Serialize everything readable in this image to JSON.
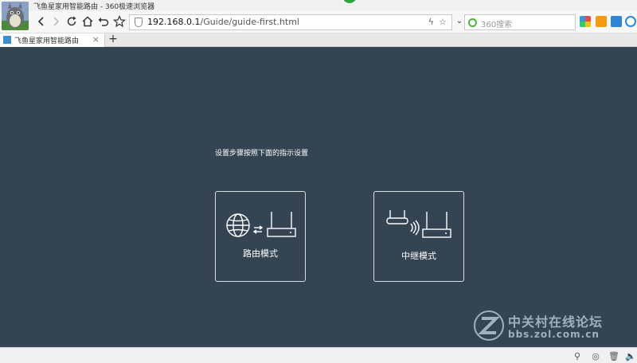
{
  "window": {
    "title": "飞鱼星家用智能路由 - 360极速浏览器"
  },
  "toolbar": {
    "back_icon": "back-arrow-icon",
    "forward_icon": "forward-arrow-icon",
    "refresh_icon": "refresh-icon",
    "home_icon": "home-icon",
    "undo_icon": "undo-icon",
    "bookmark_icon": "star-icon"
  },
  "address": {
    "host": "192.168.0.1",
    "path": "/Guide/guide-first.html"
  },
  "search": {
    "placeholder": "360搜索"
  },
  "tabs": [
    {
      "label": "飞鱼星家用智能路由",
      "close": "×"
    }
  ],
  "new_tab_label": "+",
  "page": {
    "instruction": "设置步骤按照下面的指示设置",
    "modes": [
      {
        "label": "路由模式",
        "icon": "globe-router-icon"
      },
      {
        "label": "中继模式",
        "icon": "repeater-router-icon"
      }
    ]
  },
  "watermark": {
    "title": "中关村在线论坛",
    "subtitle": "bbs.zol.com.cn"
  },
  "colors": {
    "content_bg": "#354452",
    "card_border": "#d8dde2",
    "watermark": "#9fb0c1"
  }
}
